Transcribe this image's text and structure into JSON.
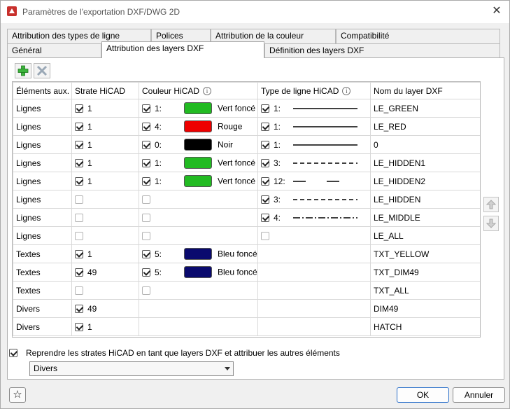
{
  "window": {
    "title": "Paramètres de l'exportation DXF/DWG 2D",
    "close": "✕"
  },
  "tabs_row1": [
    {
      "label": "Attribution des types de ligne"
    },
    {
      "label": "Polices"
    },
    {
      "label": "Attribution de la couleur"
    },
    {
      "label": "Compatibilité"
    }
  ],
  "tabs_row2": [
    {
      "label": "Général"
    },
    {
      "label": "Attribution des layers DXF",
      "active": true
    },
    {
      "label": "Définition des layers DXF"
    }
  ],
  "columns": [
    "Éléments aux.",
    "Strate HiCAD",
    "Couleur HiCAD",
    "Type de ligne HiCAD",
    "Nom du layer DXF"
  ],
  "colors": {
    "green": "#22bb22",
    "red": "#ee0000",
    "black": "#000000",
    "navy": "#0a0a6e"
  },
  "rows": [
    {
      "elem": "Lignes",
      "strate_on": true,
      "strate": "1",
      "color_on": true,
      "color_num": "1:",
      "color_hex": "#22bb22",
      "color_name": "Vert foncé",
      "lt_on": true,
      "lt_num": "1:",
      "lt": "solid",
      "layer": "LE_GREEN"
    },
    {
      "elem": "Lignes",
      "strate_on": true,
      "strate": "1",
      "color_on": true,
      "color_num": "4:",
      "color_hex": "#ee0000",
      "color_name": "Rouge",
      "lt_on": true,
      "lt_num": "1:",
      "lt": "solid",
      "layer": "LE_RED"
    },
    {
      "elem": "Lignes",
      "strate_on": true,
      "strate": "1",
      "color_on": true,
      "color_num": "0:",
      "color_hex": "#000000",
      "color_name": "Noir",
      "lt_on": true,
      "lt_num": "1:",
      "lt": "solid",
      "layer": "0"
    },
    {
      "elem": "Lignes",
      "strate_on": true,
      "strate": "1",
      "color_on": true,
      "color_num": "1:",
      "color_hex": "#22bb22",
      "color_name": "Vert foncé",
      "lt_on": true,
      "lt_num": "3:",
      "lt": "dashed",
      "layer": "LE_HIDDEN1"
    },
    {
      "elem": "Lignes",
      "strate_on": true,
      "strate": "1",
      "color_on": true,
      "color_num": "1:",
      "color_hex": "#22bb22",
      "color_name": "Vert foncé",
      "lt_on": true,
      "lt_num": "12:",
      "lt": "longdash",
      "layer": "LE_HIDDEN2"
    },
    {
      "elem": "Lignes",
      "strate_on": false,
      "strate": "",
      "color_on": false,
      "lt_on": true,
      "lt_num": "3:",
      "lt": "dashed",
      "layer": "LE_HIDDEN"
    },
    {
      "elem": "Lignes",
      "strate_on": false,
      "strate": "",
      "color_on": false,
      "lt_on": true,
      "lt_num": "4:",
      "lt": "dashdot",
      "layer": "LE_MIDDLE"
    },
    {
      "elem": "Lignes",
      "strate_on": false,
      "strate": "",
      "color_on": false,
      "lt_on": false,
      "layer": "LE_ALL"
    },
    {
      "elem": "Textes",
      "strate_on": true,
      "strate": "1",
      "color_on": true,
      "color_num": "5:",
      "color_hex": "#0a0a6e",
      "color_name": "Bleu foncé",
      "lt_none": true,
      "layer": "TXT_YELLOW"
    },
    {
      "elem": "Textes",
      "strate_on": true,
      "strate": "49",
      "color_on": true,
      "color_num": "5:",
      "color_hex": "#0a0a6e",
      "color_name": "Bleu foncé",
      "lt_none": true,
      "layer": "TXT_DIM49"
    },
    {
      "elem": "Textes",
      "strate_on": false,
      "strate": "",
      "color_on": false,
      "lt_none": true,
      "layer": "TXT_ALL"
    },
    {
      "elem": "Divers",
      "strate_on": true,
      "strate": "49",
      "color_none": true,
      "lt_none": true,
      "layer": "DIM49"
    },
    {
      "elem": "Divers",
      "strate_on": true,
      "strate": "1",
      "color_none": true,
      "lt_none": true,
      "layer": "HATCH"
    }
  ],
  "bottom": {
    "checkbox_label": "Reprendre les strates HiCAD en tant que layers DXF et attribuer les autres éléments",
    "checked": true,
    "dropdown_value": "Divers"
  },
  "buttons": {
    "ok": "OK",
    "cancel": "Annuler"
  }
}
